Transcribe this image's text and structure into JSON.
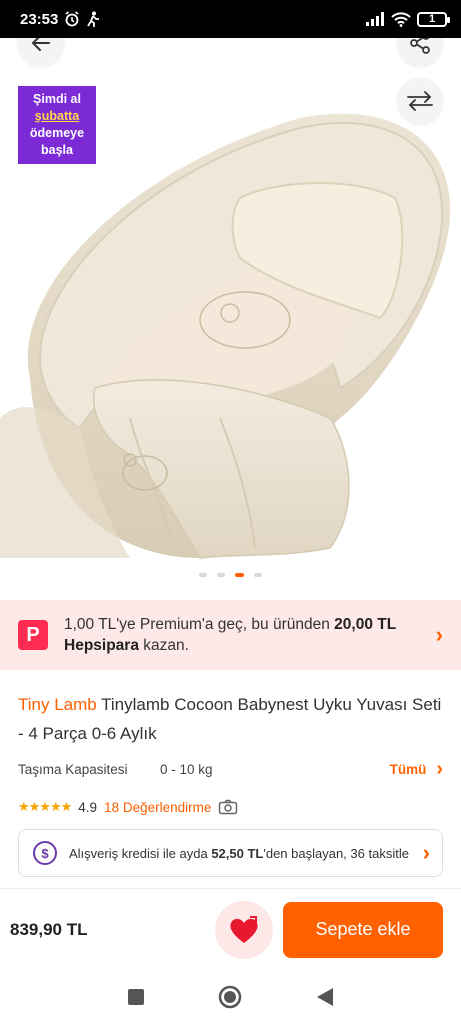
{
  "status": {
    "time": "23:53",
    "battery": "1"
  },
  "promo_badge": {
    "line1": "Şimdi al",
    "line2": "şubatta",
    "line3": "ödemeye",
    "line4": "başla"
  },
  "premium": {
    "logo": "P",
    "text_pre": "1,00 TL'ye Premium'a geç, bu üründen ",
    "amount": "20,00 TL Hepsipara",
    "text_post": " kazan."
  },
  "product": {
    "brand": "Tiny Lamb",
    "title": "Tinylamb Cocoon Babynest Uyku Yuvası Seti - 4 Parça 0-6 Aylık",
    "spec_label": "Taşıma Kapasitesi",
    "spec_value": "0 - 10 kg",
    "spec_all": "Tümü",
    "stars": "★★★★★",
    "rating": "4.9",
    "reviews": "18 Değerlendirme",
    "credit_pre": "Alışveriş kredisi ile ayda ",
    "credit_amount": "52,50 TL",
    "credit_post": "'den başlayan, 36 taksitle"
  },
  "bottom": {
    "price": "839,90 TL",
    "cart_label": "Sepete ekle"
  },
  "colors": {
    "accent": "#ff6000",
    "promo_purple": "#7b2ad6",
    "premium_bg": "#fde9e7"
  },
  "icons": [
    "back-arrow-icon",
    "share-icon",
    "compare-icon",
    "alarm-icon",
    "walk-icon",
    "signal-icon",
    "wifi-icon",
    "battery-icon",
    "camera-icon",
    "heart-icon",
    "credit-icon",
    "chevron-right-icon",
    "square-nav-icon",
    "circle-nav-icon",
    "triangle-nav-icon"
  ]
}
